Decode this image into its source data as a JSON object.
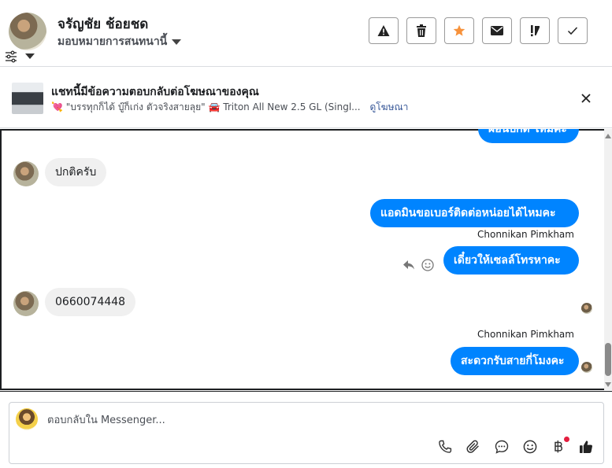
{
  "header": {
    "contact_name": "จรัญชัย ช้อยชด",
    "assign_label": "มอบหมายการสนทนานี้",
    "actions": [
      {
        "name": "report-spam",
        "icon": "warning-icon"
      },
      {
        "name": "delete",
        "icon": "trash-icon"
      },
      {
        "name": "star",
        "icon": "star-icon",
        "color": "#f7923b"
      },
      {
        "name": "mark-unread",
        "icon": "envelope-icon"
      },
      {
        "name": "follow-up",
        "icon": "flag-exclaim-icon"
      },
      {
        "name": "mark-done",
        "icon": "check-icon"
      }
    ]
  },
  "ad_banner": {
    "title": "แชทนี้มีข้อความตอบกลับต่อโฆษณาของคุณ",
    "heart_emoji": "💘",
    "subtitle_quote": "\"บรรทุกก็ได้ บู๊ก็เก่ง ตัวจริงสายลุย\"",
    "car_emoji": "🚘",
    "subtitle_model": "Triton All New 2.5 GL (Singl...",
    "link_label": "ดูโฆษณา"
  },
  "messages": [
    {
      "direction": "out",
      "text": "ผ่อนปกติ ไหมคะ",
      "partial": true
    },
    {
      "direction": "in",
      "text": "ปกติครับ"
    },
    {
      "direction": "out",
      "text": "แอดมินขอเบอร์ติดต่อหน่อยได้ไหมคะ"
    },
    {
      "direction": "out",
      "sender": "Chonnikan Pimkham",
      "text": "เดี๋ยวให้เซลล์โทรหาคะ"
    },
    {
      "direction": "in",
      "text": "0660074448"
    },
    {
      "direction": "out",
      "sender": "Chonnikan Pimkham",
      "text": "สะดวกรับสายกี่โมงคะ"
    }
  ],
  "composer": {
    "placeholder": "ตอบกลับใน Messenger...",
    "tools": [
      "phone-icon",
      "attachment-icon",
      "chat-bubble-icon",
      "emoji-icon",
      "baht-payment-icon",
      "thumbs-up-icon"
    ]
  },
  "colors": {
    "accent_blue": "#0084ff",
    "incoming_bubble": "#f0f0f0",
    "star_orange": "#f7923b",
    "link_blue": "#385898",
    "notification_red": "#e41e3f"
  }
}
